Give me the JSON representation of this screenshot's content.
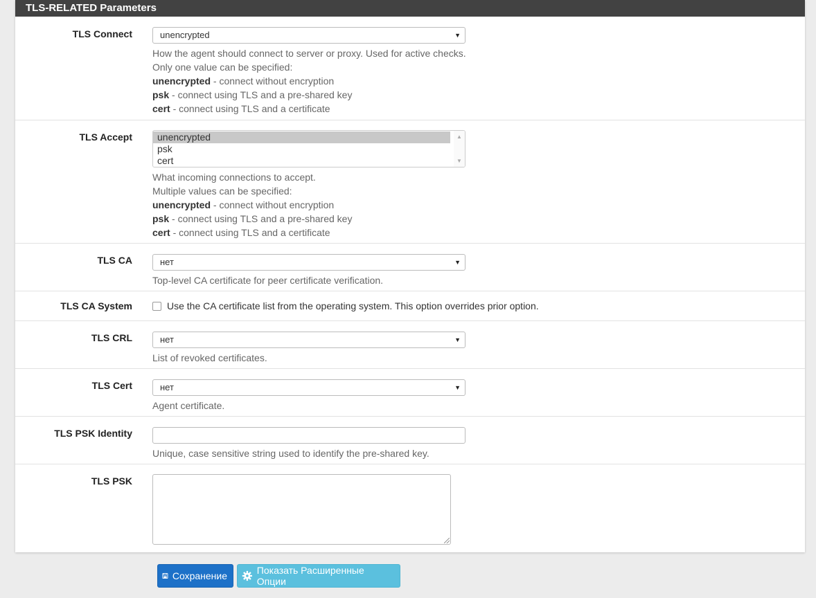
{
  "panel": {
    "title": "TLS-RELATED Parameters"
  },
  "tls_connect": {
    "label": "TLS Connect",
    "selected": "unencrypted",
    "help_line1": "How the agent should connect to server or proxy. Used for active checks.",
    "help_line2": "Only one value can be specified:",
    "opt1_term": "unencrypted",
    "opt1_desc": " - connect without encryption",
    "opt2_term": "psk",
    "opt2_desc": " - connect using TLS and a pre-shared key",
    "opt3_term": "cert",
    "opt3_desc": " - connect using TLS and a certificate"
  },
  "tls_accept": {
    "label": "TLS Accept",
    "options": [
      "unencrypted",
      "psk",
      "cert"
    ],
    "help_line1": "What incoming connections to accept.",
    "help_line2": "Multiple values can be specified:",
    "opt1_term": "unencrypted",
    "opt1_desc": " - connect without encryption",
    "opt2_term": "psk",
    "opt2_desc": " - connect using TLS and a pre-shared key",
    "opt3_term": "cert",
    "opt3_desc": " - connect using TLS and a certificate"
  },
  "tls_ca": {
    "label": "TLS CA",
    "selected": "нет",
    "help": "Top-level CA certificate for peer certificate verification."
  },
  "tls_ca_system": {
    "label": "TLS CA System",
    "checkbox_text": "Use the CA certificate list from the operating system. This option overrides prior option."
  },
  "tls_crl": {
    "label": "TLS CRL",
    "selected": "нет",
    "help": "List of revoked certificates."
  },
  "tls_cert": {
    "label": "TLS Cert",
    "selected": "нет",
    "help": "Agent certificate."
  },
  "tls_psk_identity": {
    "label": "TLS PSK Identity",
    "value": "",
    "help": "Unique, case sensitive string used to identify the pre-shared key."
  },
  "tls_psk": {
    "label": "TLS PSK",
    "value": ""
  },
  "buttons": {
    "save": "Сохранение",
    "advanced": "Показать Расширенные Опции"
  },
  "colors": {
    "header_bg": "#424242",
    "save_btn": "#1d71c8",
    "advanced_btn": "#5bc0de"
  }
}
